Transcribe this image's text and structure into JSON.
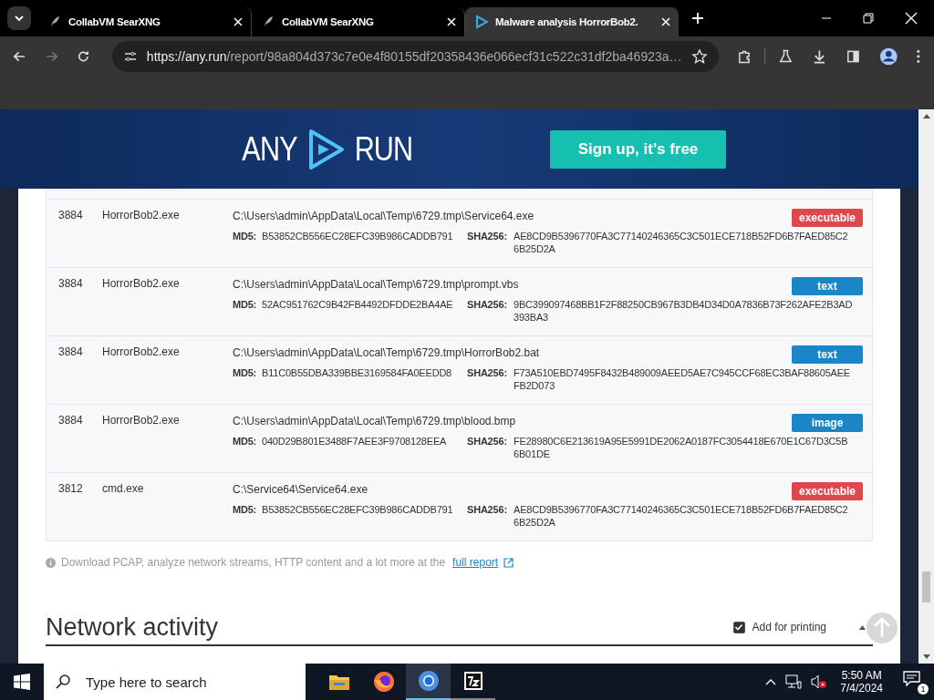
{
  "browser": {
    "tabs": [
      {
        "title": "CollabVM SearXNG",
        "selected": false
      },
      {
        "title": "CollabVM SearXNG",
        "selected": false
      },
      {
        "title": "Malware analysis HorrorBob2.",
        "selected": true
      }
    ],
    "url_host": "https://any.run",
    "url_path": "/report/98a804d373c7e0e4f80155df20358436e066ecf31c522c31df2ba46923a…"
  },
  "header": {
    "logo_left": "ANY",
    "logo_right": "RUN",
    "signup": "Sign up, it’s free"
  },
  "files": {
    "rows": [
      {
        "pid": "3884",
        "process": "HorrorBob2.exe",
        "path": "C:\\Users\\admin\\AppData\\Local\\Temp\\6729.tmp\\Service64.exe",
        "md5_label": "MD5:",
        "sha_label": "SHA256:",
        "md5": "B53852CB556EC28EFC39B986CADDB791",
        "sha256": "AE8CD9B5396770FA3C77140246365C3C501ECE718B52FD6B7FAED85C26B25D2A",
        "type": "executable",
        "kind": "executable"
      },
      {
        "pid": "3884",
        "process": "HorrorBob2.exe",
        "path": "C:\\Users\\admin\\AppData\\Local\\Temp\\6729.tmp\\prompt.vbs",
        "md5_label": "MD5:",
        "sha_label": "SHA256:",
        "md5": "52AC951762C9B42FB4492DFDDE2BA4AE",
        "sha256": "9BC399097468BB1F2F88250CB967B3DB4D34D0A7836B73F262AFE2B3AD393BA3",
        "type": "text",
        "kind": "text"
      },
      {
        "pid": "3884",
        "process": "HorrorBob2.exe",
        "path": "C:\\Users\\admin\\AppData\\Local\\Temp\\6729.tmp\\HorrorBob2.bat",
        "md5_label": "MD5:",
        "sha_label": "SHA256:",
        "md5": "B11C0B55DBA339BBE3169584FA0EEDD8",
        "sha256": "F73A510EBD7495F8432B489009AEED5AE7C945CCF68EC3BAF88605AEEFB2D073",
        "type": "text",
        "kind": "text"
      },
      {
        "pid": "3884",
        "process": "HorrorBob2.exe",
        "path": "C:\\Users\\admin\\AppData\\Local\\Temp\\6729.tmp\\blood.bmp",
        "md5_label": "MD5:",
        "sha_label": "SHA256:",
        "md5": "040D29B801E3488F7AEE3F9708128EEA",
        "sha256": "FE28980C6E213619A95E5991DE2062A0187FC3054418E670E1C67D3C5B6B01DE",
        "type": "image",
        "kind": "image"
      },
      {
        "pid": "3812",
        "process": "cmd.exe",
        "path": "C:\\Service64\\Service64.exe",
        "md5_label": "MD5:",
        "sha_label": "SHA256:",
        "md5": "B53852CB556EC28EFC39B986CADDB791",
        "sha256": "AE8CD9B5396770FA3C77140246365C3C501ECE718B52FD6B7FAED85C26B25D2A",
        "type": "executable",
        "kind": "executable"
      }
    ]
  },
  "note": {
    "text": "Download PCAP, analyze network streams, HTTP content and a lot more at the",
    "link": "full report"
  },
  "section": {
    "title": "Network activity",
    "print_label": "Add for printing",
    "print_checked": true
  },
  "taskbar": {
    "search_placeholder": "Type here to search",
    "time": "5:50 AM",
    "date": "7/4/2024",
    "notifications": "1"
  }
}
